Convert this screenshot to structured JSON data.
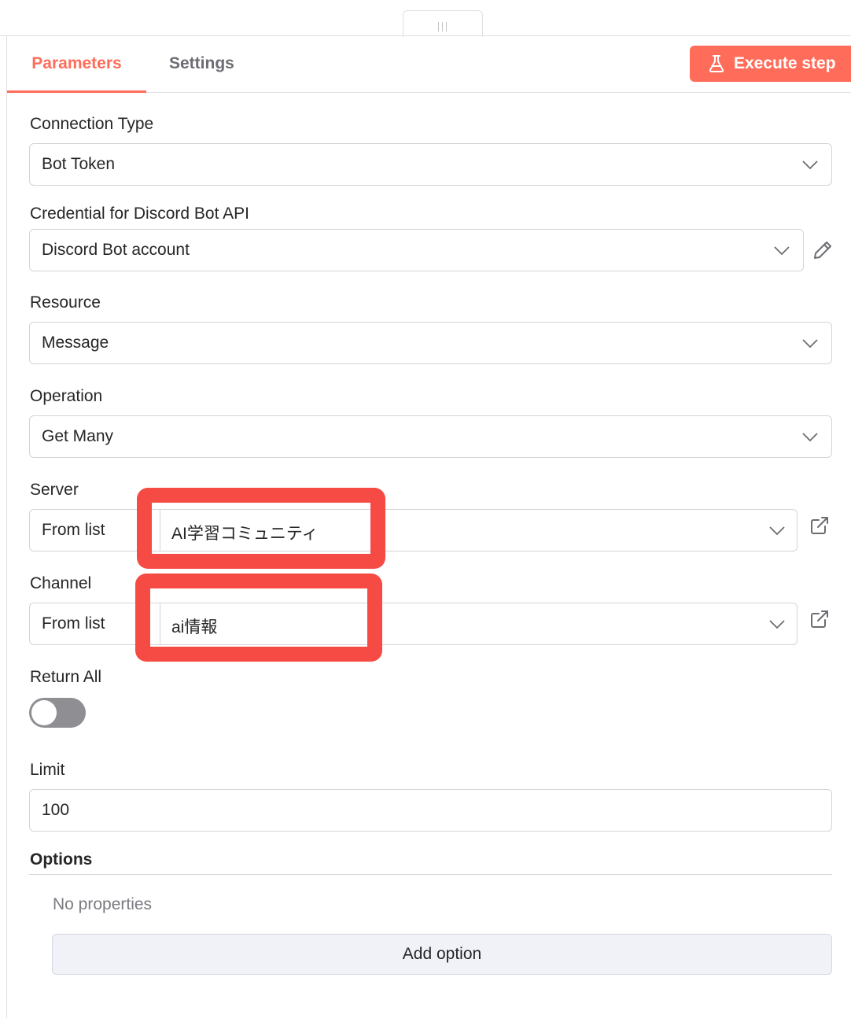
{
  "tabs": [
    {
      "label": "Parameters",
      "active": true
    },
    {
      "label": "Settings",
      "active": false
    }
  ],
  "execute_button": {
    "label": "Execute step",
    "icon": "flask-icon",
    "color": "#ff6d5a"
  },
  "fields": {
    "connection_type": {
      "label": "Connection Type",
      "value": "Bot Token"
    },
    "credential": {
      "label": "Credential for Discord Bot API",
      "value": "Discord Bot account",
      "edit_icon": "pencil-icon"
    },
    "resource": {
      "label": "Resource",
      "value": "Message"
    },
    "operation": {
      "label": "Operation",
      "value": "Get Many"
    },
    "server": {
      "label": "Server",
      "mode": "From list",
      "value": "AI学習コミュニティ",
      "link_icon": "external-link-icon"
    },
    "channel": {
      "label": "Channel",
      "mode": "From list",
      "value": "ai情報",
      "link_icon": "external-link-icon"
    },
    "return_all": {
      "label": "Return All",
      "enabled": false
    },
    "limit": {
      "label": "Limit",
      "value": "100"
    }
  },
  "options": {
    "title": "Options",
    "empty_text": "No properties",
    "add_button": "Add option"
  },
  "annotation_color": "#f64a45"
}
